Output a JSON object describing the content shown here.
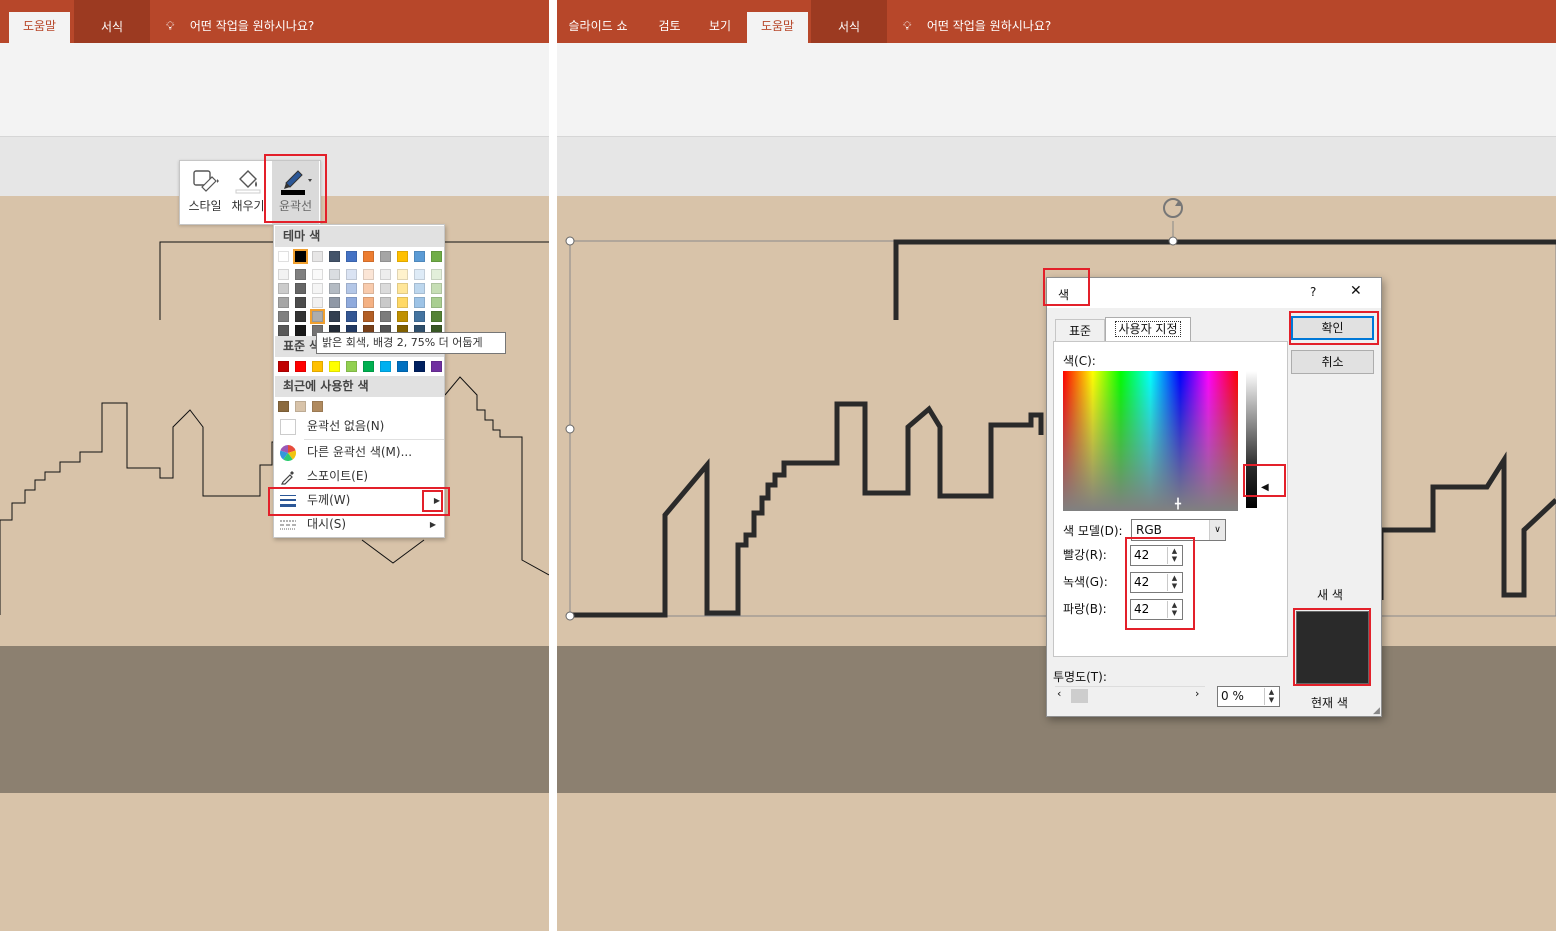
{
  "colors": {
    "ribbon": "#b7472a",
    "ribbon_dark": "#9c3a21",
    "tan": "#d8c3a9",
    "ground": "#8c8070",
    "highlight": "#e3202a",
    "outline_color": "#2a2a2a"
  },
  "left": {
    "tabs": [
      "도움말",
      "서식"
    ],
    "tell_me": "어떤 작업을 원하시나요?",
    "mini_toolbar": {
      "style": "스타일",
      "fill": "채우기",
      "outline": "윤곽선"
    },
    "dropdown": {
      "theme_header": "테마 색",
      "standard_header": "표준 색",
      "recent_header": "최근에 사용한 색",
      "no_outline": "윤곽선 없음(N)",
      "more_colors": "다른 윤곽선 색(M)...",
      "eyedropper": "스포이트(E)",
      "weight": "두께(W)",
      "dashes": "대시(S)",
      "theme_colors": [
        "#ffffff",
        "#000000",
        "#e7e6e6",
        "#44546a",
        "#4472c4",
        "#ed7d31",
        "#a5a5a5",
        "#ffc000",
        "#5b9bd5",
        "#70ad47"
      ],
      "standard_colors": [
        "#c00000",
        "#ff0000",
        "#ffc000",
        "#ffff00",
        "#92d050",
        "#00b050",
        "#00b0f0",
        "#0070c0",
        "#002060",
        "#7030a0"
      ],
      "recent_colors": [
        "#8b6a3e",
        "#d8c3a9",
        "#b08a5f"
      ]
    },
    "tooltip": "밝은 회색, 배경 2, 75% 더 어둡게"
  },
  "right": {
    "tabs": [
      "슬라이드 쇼",
      "검토",
      "보기",
      "도움말",
      "서식"
    ],
    "tell_me": "어떤 작업을 원하시나요?",
    "dialog": {
      "title": "색",
      "help": "?",
      "close": "✕",
      "tab_standard": "표준",
      "tab_custom": "사용자 지정",
      "colors_label": "색(C):",
      "model_label": "색 모델(D):",
      "model_value": "RGB",
      "red_label": "빨강(R):",
      "green_label": "녹색(G):",
      "blue_label": "파랑(B):",
      "red": "42",
      "green": "42",
      "blue": "42",
      "transparency_label": "투명도(T):",
      "transparency": "0 %",
      "ok": "확인",
      "cancel": "취소",
      "new_label": "새 색",
      "current_label": "현재 색"
    }
  }
}
